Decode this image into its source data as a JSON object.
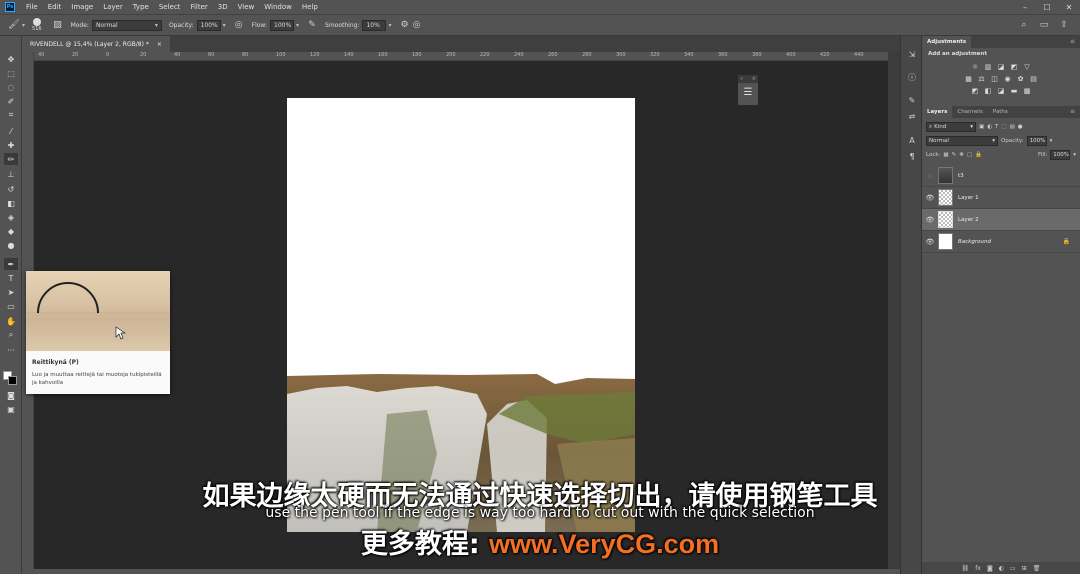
{
  "menu": {
    "app_icon": "Ps",
    "items": [
      "File",
      "Edit",
      "Image",
      "Layer",
      "Type",
      "Select",
      "Filter",
      "3D",
      "View",
      "Window",
      "Help"
    ],
    "window_controls": [
      "minimize-icon",
      "maximize-icon",
      "close-icon"
    ]
  },
  "options": {
    "brush_size": "516",
    "mode_label": "Mode:",
    "mode_value": "Normal",
    "opacity_label": "Opacity:",
    "opacity_value": "100%",
    "flow_label": "Flow:",
    "flow_value": "100%",
    "smoothing_label": "Smoothing:",
    "smoothing_value": "10%"
  },
  "document": {
    "tab_title": "RIVENDELL @ 15,4% (Layer 2, RGB/8) *",
    "close_glyph": "×",
    "ruler_ticks": [
      "40",
      "20",
      "0",
      "20",
      "40",
      "60",
      "80",
      "100",
      "120",
      "140",
      "160",
      "180",
      "200",
      "220",
      "240",
      "260",
      "280",
      "300",
      "320",
      "340",
      "360",
      "380",
      "400",
      "420",
      "440",
      "460"
    ]
  },
  "tooltip": {
    "title": "Reittikynä (P)",
    "description": "Luo ja muuttaa reittejä tai muotoja tukipisteillä ja kahvoilla"
  },
  "adjustments": {
    "tab_label": "Adjustments",
    "subtitle": "Add an adjustment"
  },
  "layers_panel": {
    "tabs": [
      "Layers",
      "Channels",
      "Paths"
    ],
    "filter_kind": "Kind",
    "blend_mode": "Normal",
    "opacity_label": "Opacity:",
    "opacity_value": "100%",
    "lock_label": "Lock:",
    "fill_label": "Fill:",
    "fill_value": "100%",
    "layers": [
      {
        "name": "t3",
        "visible": false,
        "selected": false
      },
      {
        "name": "Layer 1",
        "visible": true,
        "selected": false
      },
      {
        "name": "Layer 2",
        "visible": true,
        "selected": true
      },
      {
        "name": "Background",
        "visible": true,
        "selected": false,
        "locked": true
      }
    ]
  },
  "subtitles": {
    "chinese": "如果边缘太硬而无法通过快速选择切出，请使用钢笔工具",
    "english": "use the pen tool if the edge is way too hard to cut out with the quick selection",
    "promo_prefix": "更多教程: ",
    "promo_url": "www.VeryCG.com"
  },
  "colors": {
    "promo_accent": "#f36f22",
    "panel_bg": "#535353",
    "canvas_bg": "#282828"
  }
}
